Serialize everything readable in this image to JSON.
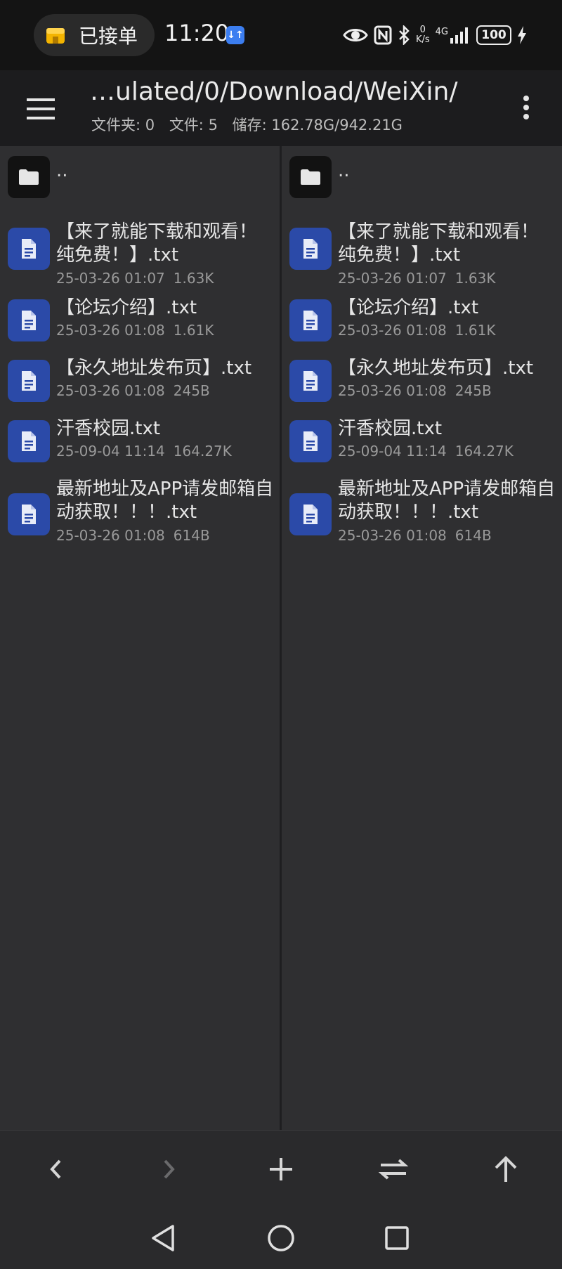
{
  "status_bar": {
    "pill_text": "已接单",
    "time": "11:20",
    "net_speed_value": "0",
    "net_speed_unit": "K/s",
    "network_label": "4G",
    "battery": "100"
  },
  "app_bar": {
    "path": "…ulated/0/Download/WeiXin/",
    "folders": "文件夹: 0",
    "files": "文件: 5",
    "storage": "储存: 162.78G/942.21G"
  },
  "panes": {
    "parent_label": "..",
    "files": [
      {
        "name": "【来了就能下载和观看！纯免费！】.txt",
        "date": "25-03-26 01:07",
        "size": "1.63K"
      },
      {
        "name": "【论坛介绍】.txt",
        "date": "25-03-26 01:08",
        "size": "1.61K"
      },
      {
        "name": "【永久地址发布页】.txt",
        "date": "25-03-26 01:08",
        "size": "245B"
      },
      {
        "name": "汗香校园.txt",
        "date": "25-09-04 11:14",
        "size": "164.27K"
      },
      {
        "name": "最新地址及APP请发邮箱自动获取！！！.txt",
        "date": "25-03-26 01:08",
        "size": "614B"
      }
    ]
  },
  "icons": {
    "menu": "hamburger-menu-icon",
    "more": "more-vertical-icon",
    "folder": "folder-icon",
    "file": "text-file-icon",
    "back": "chevron-left-icon",
    "forward": "chevron-right-icon",
    "add": "plus-icon",
    "swap": "swap-panes-icon",
    "up": "arrow-up-icon"
  },
  "colors": {
    "file_icon_bg": "#2b4aa8",
    "background": "#2f2f31",
    "app_bar": "#1c1c1e"
  }
}
